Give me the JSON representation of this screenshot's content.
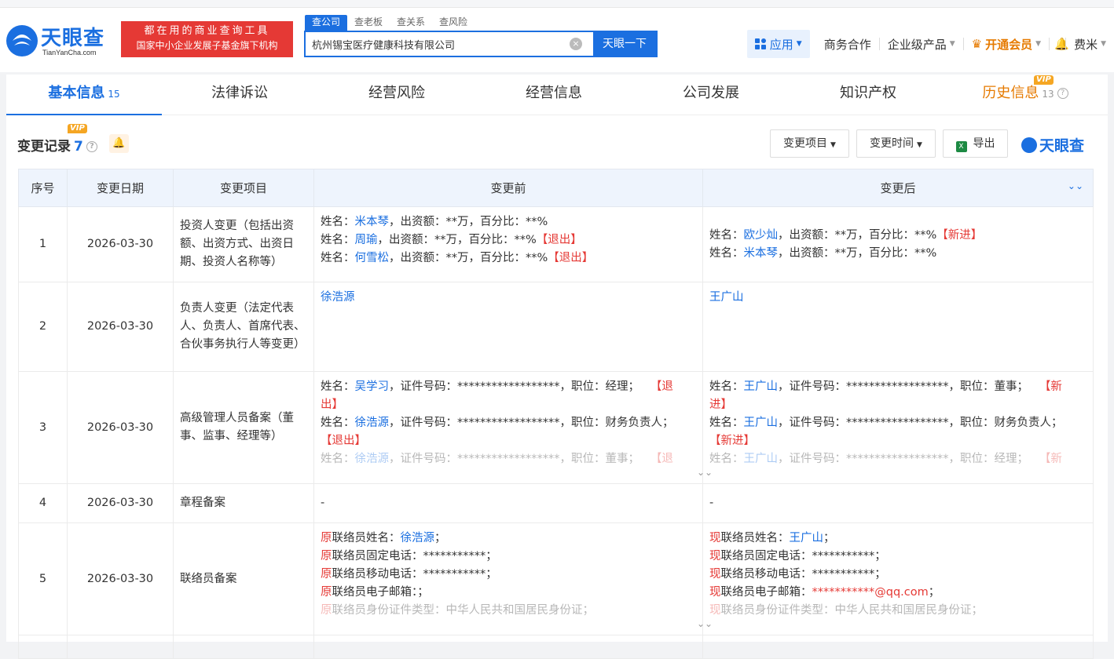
{
  "header": {
    "logo_text": "天眼查",
    "logo_sub": "TianYanCha.com",
    "banner_line1": "都在用的商业查询工具",
    "banner_line2": "国家中小企业发展子基金旗下机构",
    "search_tabs": [
      "查公司",
      "查老板",
      "查关系",
      "查风险"
    ],
    "search_value": "杭州锡宝医疗健康科技有限公司",
    "clear_symbol": "×",
    "search_button": "天眼一下",
    "app_label": "应用",
    "nav": [
      "商务合作",
      "企业级产品"
    ],
    "vip_label": "开通会员",
    "user": "费米"
  },
  "tabs": [
    {
      "label": "基本信息",
      "count": "15"
    },
    {
      "label": "法律诉讼",
      "count": ""
    },
    {
      "label": "经营风险",
      "count": ""
    },
    {
      "label": "经营信息",
      "count": ""
    },
    {
      "label": "公司发展",
      "count": ""
    },
    {
      "label": "知识产权",
      "count": ""
    },
    {
      "label": "历史信息",
      "count": "13"
    }
  ],
  "vip_badge": "VIP",
  "section": {
    "title": "变更记录",
    "count": "7",
    "btn_item": "变更项目",
    "btn_time": "变更时间",
    "btn_export": "导出",
    "brand": "天眼查"
  },
  "table": {
    "headers": [
      "序号",
      "变更日期",
      "变更项目",
      "变更前",
      "变更后"
    ],
    "rows": [
      {
        "no": "1",
        "date": "2026-03-30",
        "item": "投资人变更（包括出资额、出资方式、出资日期、投资人名称等）"
      },
      {
        "no": "2",
        "date": "2026-03-30",
        "item": "负责人变更（法定代表人、负责人、首席代表、合伙事务执行人等变更）"
      },
      {
        "no": "3",
        "date": "2026-03-30",
        "item": "高级管理人员备案（董事、监事、经理等）"
      },
      {
        "no": "4",
        "date": "2026-03-30",
        "item": "章程备案"
      },
      {
        "no": "5",
        "date": "2026-03-30",
        "item": "联络员备案"
      }
    ],
    "r1_before": [
      {
        "pre": "姓名：",
        "name": "米本琴",
        "post": "，出资额：**万，百分比：**%",
        "tag": ""
      },
      {
        "pre": "姓名：",
        "name": "周瑜",
        "post": "，出资额：**万，百分比：**%",
        "tag": "【退出】"
      },
      {
        "pre": "姓名：",
        "name": "何雪松",
        "post": "，出资额：**万，百分比：**%",
        "tag": "【退出】"
      }
    ],
    "r1_after": [
      {
        "pre": "姓名：",
        "name": "欧少灿",
        "post": "，出资额：**万，百分比：**%",
        "tag": "【新进】"
      },
      {
        "pre": "姓名：",
        "name": "米本琴",
        "post": "，出资额：**万，百分比：**%",
        "tag": ""
      }
    ],
    "r2_before": "徐浩源",
    "r2_after": "王广山",
    "r3_before": [
      {
        "name": "吴学习",
        "mid": "，证件号码：******************，职位：经理；",
        "tag1": "【退",
        "tag2": "出】"
      },
      {
        "name": "徐浩源",
        "mid": "，证件号码：******************，职位：财务负责人；",
        "tag1": "",
        "tag2": "【退出】"
      },
      {
        "name": "徐浩源",
        "mid": "，证件号码：******************，职位：董事；",
        "tag1": "【退",
        "tag2": ""
      }
    ],
    "r3_after": [
      {
        "name": "王广山",
        "mid": "，证件号码：******************，职位：董事；",
        "tag1": "【新",
        "tag2": "进】"
      },
      {
        "name": "王广山",
        "mid": "，证件号码：******************，职位：财务负责人；",
        "tag1": "",
        "tag2": "【新进】"
      },
      {
        "name": "王广山",
        "mid": "，证件号码：******************，职位：经理；",
        "tag1": "【新",
        "tag2": ""
      }
    ],
    "name_label": "姓名：",
    "r4_before": "-",
    "r4_after": "-",
    "r5_before": {
      "prefix": "原",
      "name_label": "联络员姓名：",
      "name": "徐浩源",
      "semi": "；",
      "phone": "联络员固定电话：***********；",
      "mobile": "联络员移动电话：***********；",
      "email": "联络员电子邮箱：；",
      "id": "联络员身份证件类型：中华人民共和国居民身份证；"
    },
    "r5_after": {
      "prefix": "现",
      "name_label": "联络员姓名：",
      "name": "王广山",
      "semi": "；",
      "phone": "联络员固定电话：***********；",
      "mobile": "联络员移动电话：***********；",
      "email_label": "联络员电子邮箱：",
      "email_stars": "***********",
      "email_domain": "@qq.com",
      "email_semi": "；",
      "id": "联络员身份证件类型：中华人民共和国居民身份证；"
    }
  }
}
